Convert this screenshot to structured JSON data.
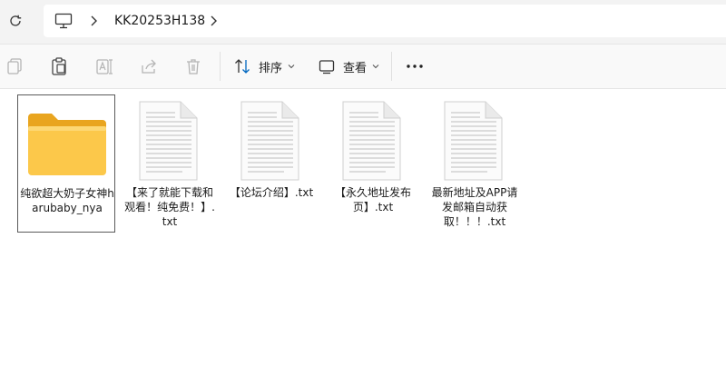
{
  "breadcrumb": {
    "current": "KK20253H138"
  },
  "toolbar": {
    "sort_label": "排序",
    "view_label": "查看"
  },
  "files": [
    {
      "name": "纯欲超大奶子女神harubaby_nya",
      "kind": "folder",
      "selected": true
    },
    {
      "name": "【来了就能下载和观看！纯免费！】.txt",
      "kind": "txt",
      "selected": false
    },
    {
      "name": "【论坛介绍】.txt",
      "kind": "txt",
      "selected": false
    },
    {
      "name": "【永久地址发布页】.txt",
      "kind": "txt",
      "selected": false
    },
    {
      "name": "最新地址及APP请发邮箱自动获取！！！.txt",
      "kind": "txt",
      "selected": false
    }
  ],
  "colors": {
    "folder_front": "#fcc84a",
    "folder_back": "#e9a51f",
    "accent": "#0067c0"
  }
}
